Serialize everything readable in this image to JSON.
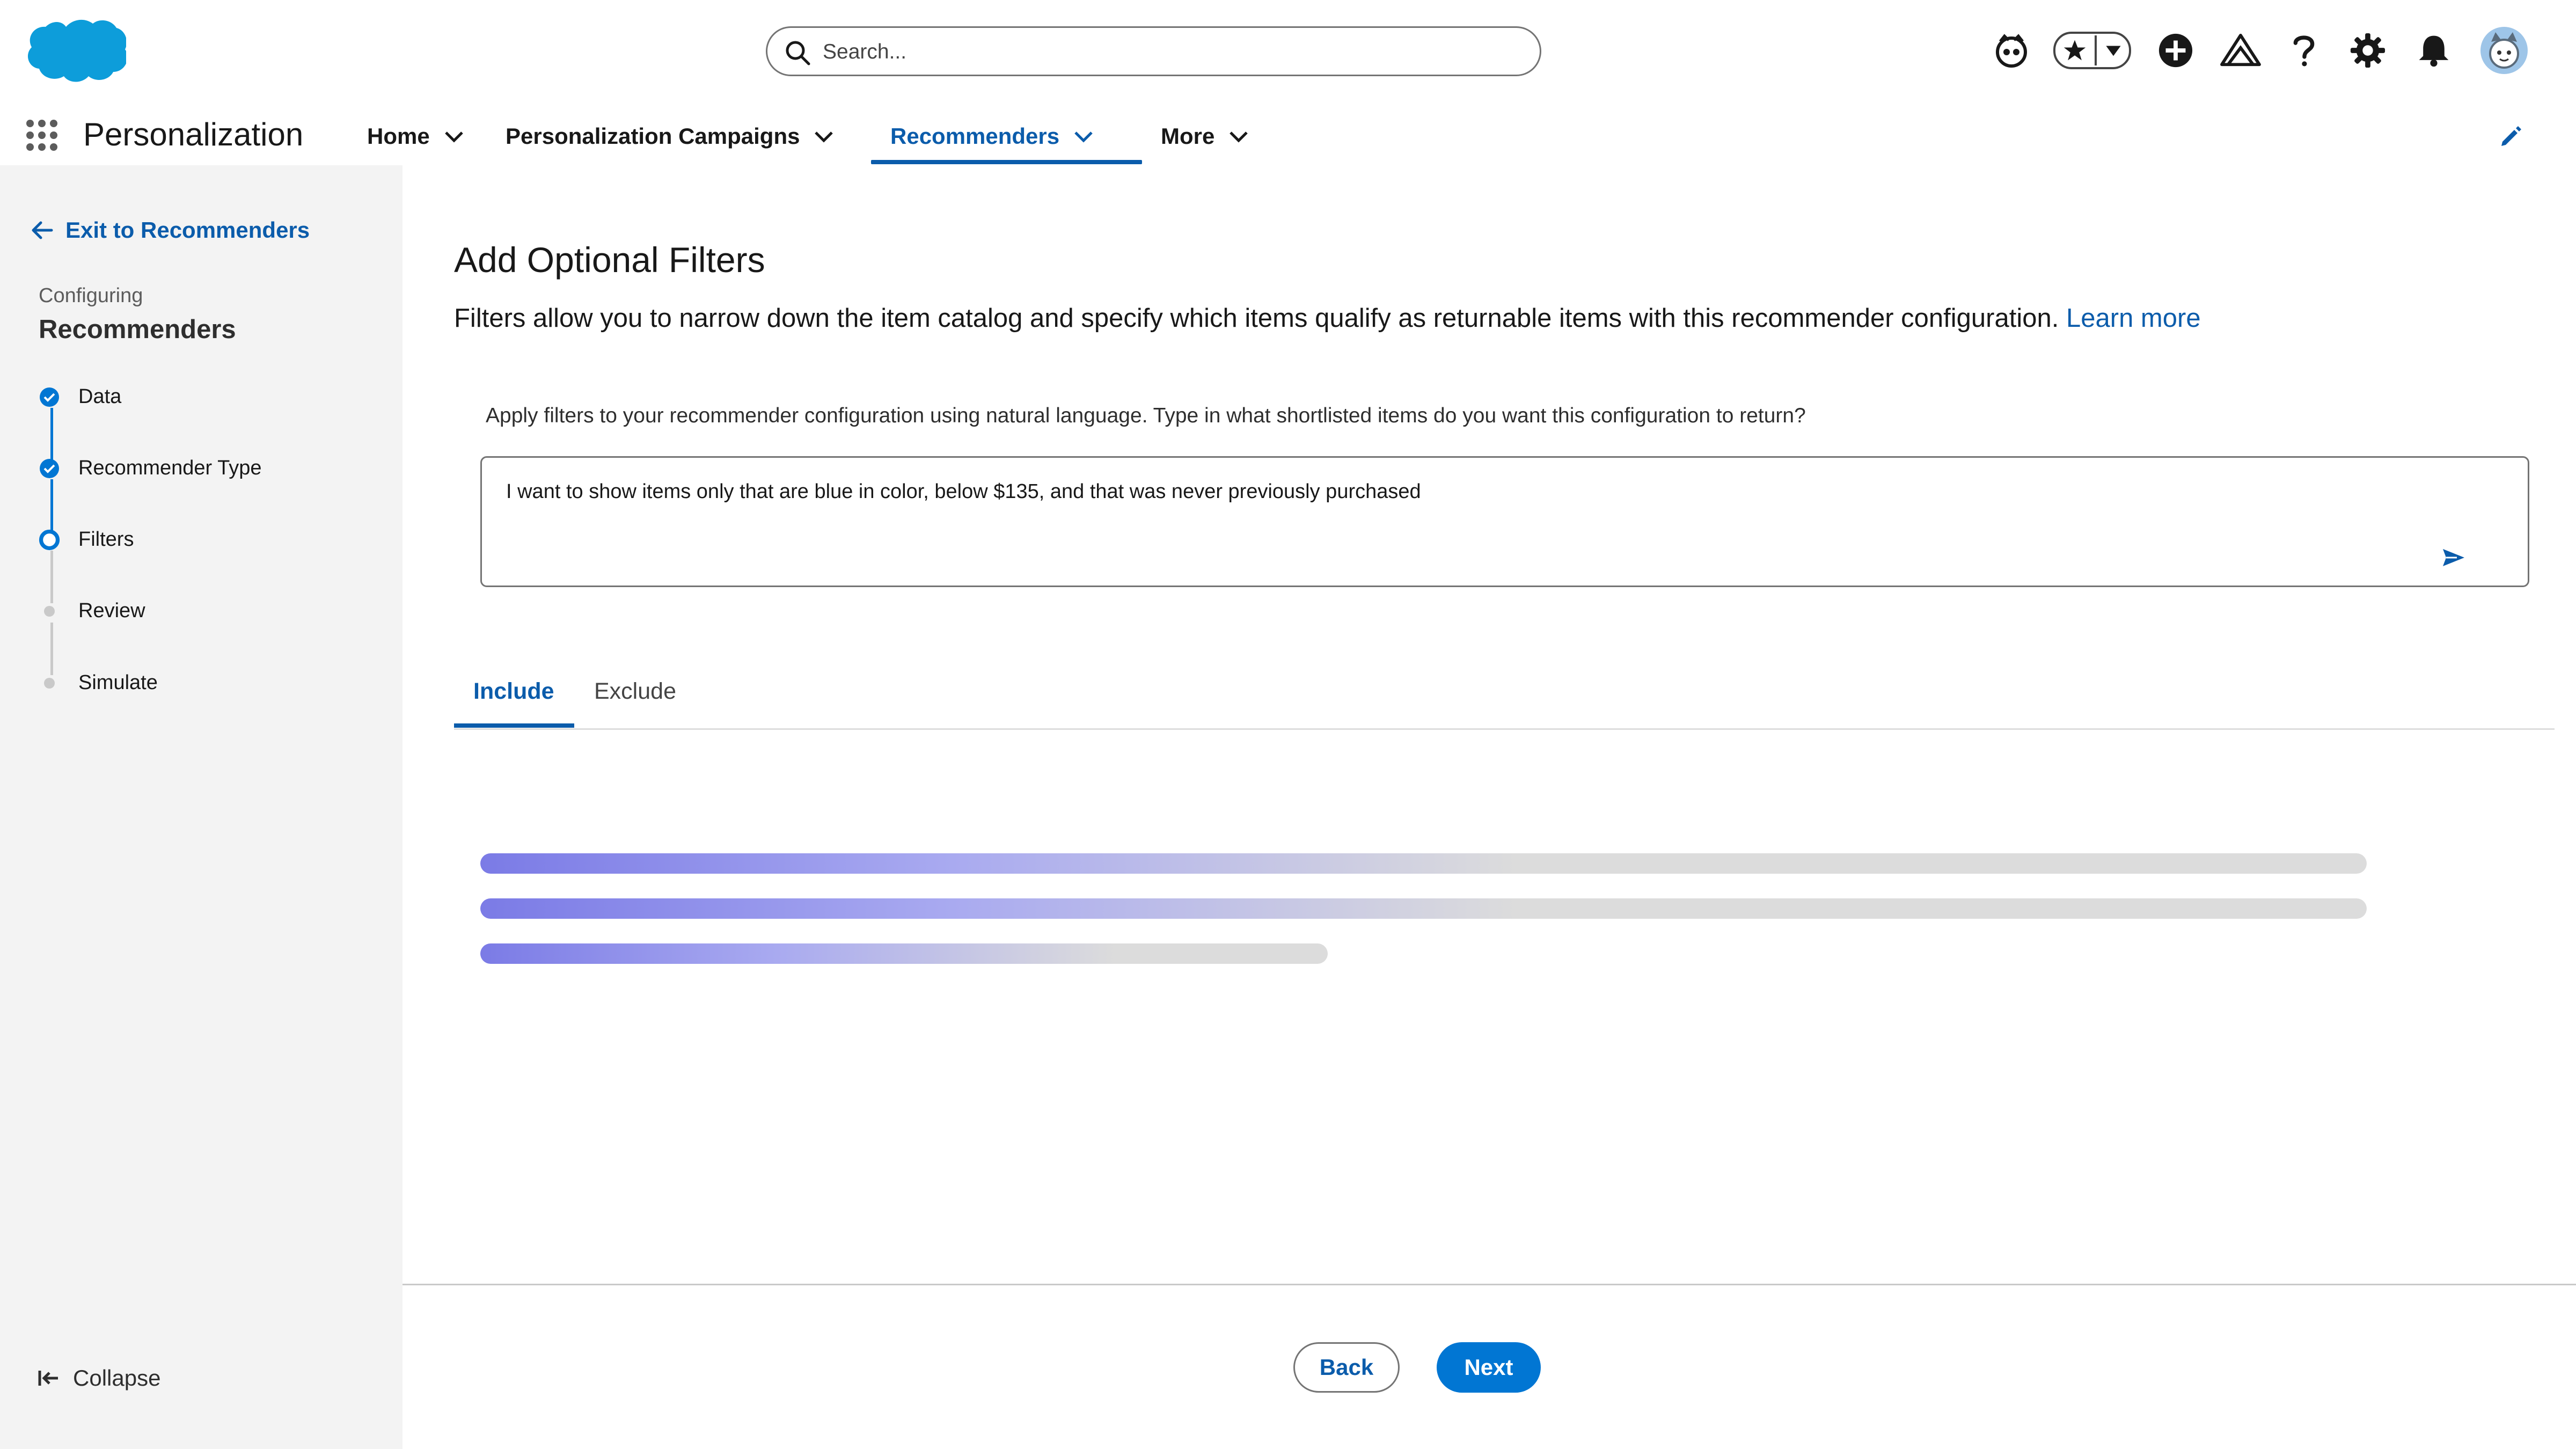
{
  "header": {
    "search_placeholder": "Search...",
    "icons": [
      "einstein-icon",
      "favorites-star-icon",
      "favorites-dropdown-icon",
      "add-icon",
      "trailhead-icon",
      "help-icon",
      "setup-gear-icon",
      "notifications-bell-icon",
      "user-avatar"
    ]
  },
  "app_nav": {
    "app_name": "Personalization",
    "items": [
      {
        "label": "Home"
      },
      {
        "label": "Personalization Campaigns"
      },
      {
        "label": "Recommenders",
        "active": true
      },
      {
        "label": "More"
      }
    ]
  },
  "sidebar": {
    "exit_label": "Exit to Recommenders",
    "configuring_label": "Configuring",
    "configuring_title": "Recommenders",
    "steps": [
      {
        "label": "Data",
        "state": "complete"
      },
      {
        "label": "Recommender Type",
        "state": "complete"
      },
      {
        "label": "Filters",
        "state": "current"
      },
      {
        "label": "Review",
        "state": "pending"
      },
      {
        "label": "Simulate",
        "state": "pending"
      }
    ],
    "collapse_label": "Collapse"
  },
  "main": {
    "title": "Add Optional Filters",
    "description": "Filters allow you to narrow down the item catalog and specify which items qualify as returnable items with this recommender configuration.",
    "learn_more": "Learn more",
    "nl_prompt": "Apply filters to your recommender configuration using natural language. Type in what shortlisted items do you want this configuration to return?",
    "nl_input_value": "I want to show items only that are blue in color, below $135, and that was never previously purchased",
    "tabs": [
      {
        "label": "Include",
        "active": true
      },
      {
        "label": "Exclude",
        "active": false
      }
    ]
  },
  "footer": {
    "back_label": "Back",
    "next_label": "Next"
  },
  "colors": {
    "brand_blue": "#0b5cab",
    "button_blue": "#0176d3",
    "sidebar_bg": "#f3f3f3",
    "skeleton_start": "#7b7be6",
    "skeleton_end": "#dcdcdc"
  }
}
